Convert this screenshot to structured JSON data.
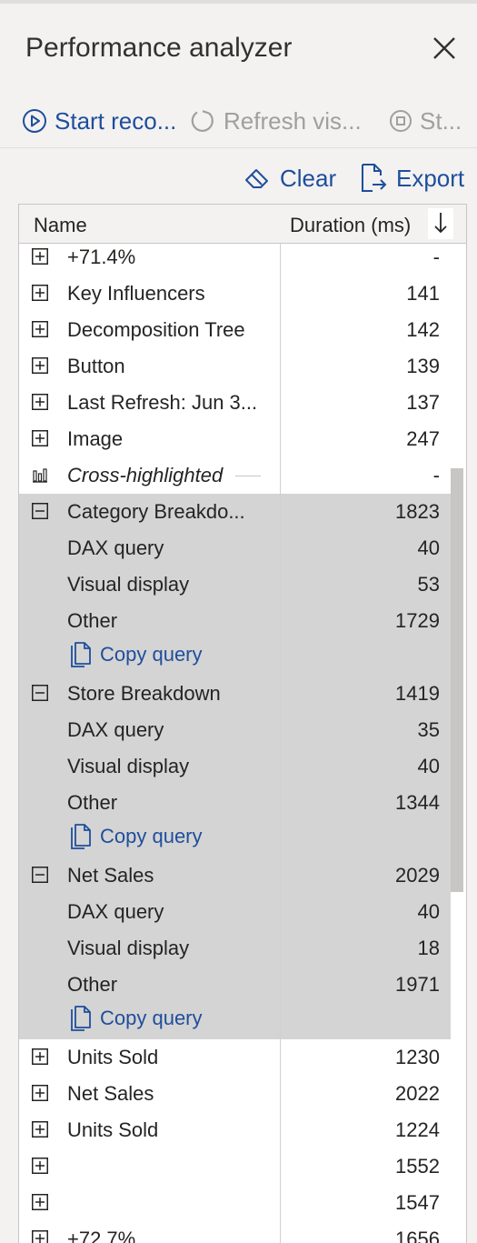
{
  "panel": {
    "title": "Performance analyzer"
  },
  "toolbar": {
    "start_label": "Start reco...",
    "refresh_label": "Refresh vis...",
    "stop_label": "St..."
  },
  "actions": {
    "clear_label": "Clear",
    "export_label": "Export"
  },
  "table": {
    "col_name": "Name",
    "col_duration": "Duration (ms)",
    "sort_glyph": "↓",
    "rows": [
      {
        "name": "+71.4%",
        "duration": "-"
      },
      {
        "name": "Key Influencers",
        "duration": "141"
      },
      {
        "name": "Decomposition Tree",
        "duration": "142"
      },
      {
        "name": "Button",
        "duration": "139"
      },
      {
        "name": "Last Refresh: Jun 3...",
        "duration": "137"
      },
      {
        "name": "Image",
        "duration": "247"
      },
      {
        "name": "Cross-highlighted",
        "duration": "-"
      },
      {
        "name": "Category Breakdo...",
        "duration": "1823"
      },
      {
        "name": "DAX query",
        "duration": "40"
      },
      {
        "name": "Visual display",
        "duration": "53"
      },
      {
        "name": "Other",
        "duration": "1729"
      },
      {
        "name": "Store Breakdown",
        "duration": "1419"
      },
      {
        "name": "DAX query",
        "duration": "35"
      },
      {
        "name": "Visual display",
        "duration": "40"
      },
      {
        "name": "Other",
        "duration": "1344"
      },
      {
        "name": "Net Sales",
        "duration": "2029"
      },
      {
        "name": "DAX query",
        "duration": "40"
      },
      {
        "name": "Visual display",
        "duration": "18"
      },
      {
        "name": "Other",
        "duration": "1971"
      },
      {
        "name": "Units Sold",
        "duration": "1230"
      },
      {
        "name": "Net Sales",
        "duration": "2022"
      },
      {
        "name": "Units Sold",
        "duration": "1224"
      },
      {
        "name": "",
        "duration": "1552"
      },
      {
        "name": "",
        "duration": "1547"
      },
      {
        "name": "+72.7%",
        "duration": "1656"
      }
    ],
    "copy_query_label": "Copy query"
  },
  "colors": {
    "accent": "#1f4e9c",
    "disabled": "#a19f9d",
    "selected_band": "#d4d4d4"
  }
}
